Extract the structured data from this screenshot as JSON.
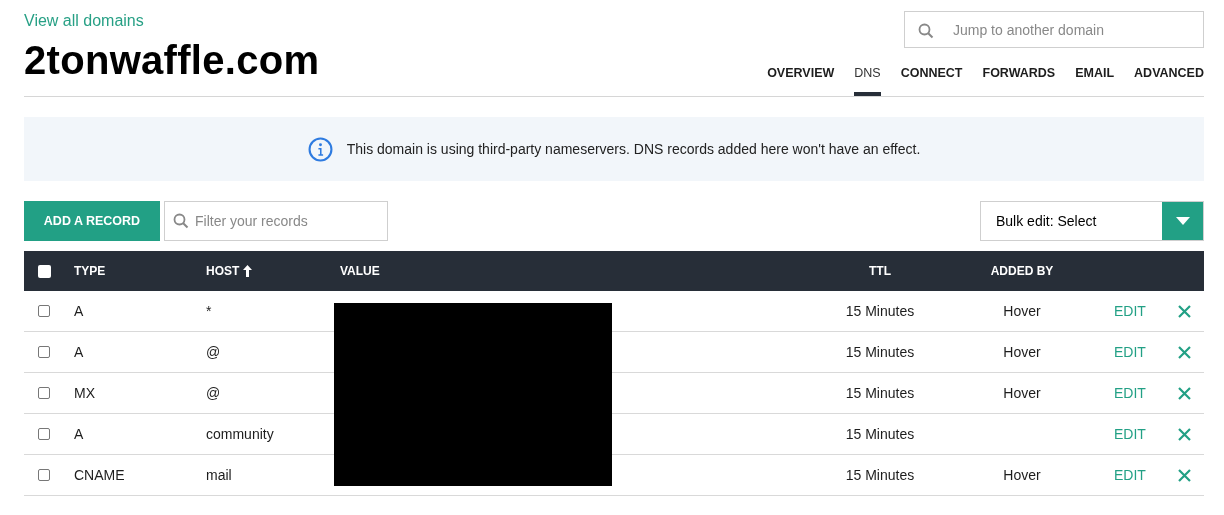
{
  "back_link": "View all domains",
  "domain_title": "2tonwaffle.com",
  "jump_search": {
    "placeholder": "Jump to another domain"
  },
  "tabs": [
    {
      "label": "OVERVIEW",
      "selected": false
    },
    {
      "label": "DNS",
      "selected": true
    },
    {
      "label": "CONNECT",
      "selected": false
    },
    {
      "label": "FORWARDS",
      "selected": false
    },
    {
      "label": "EMAIL",
      "selected": false
    },
    {
      "label": "ADVANCED",
      "selected": false
    }
  ],
  "notice": "This domain is using third-party nameservers. DNS records added here won't have an effect.",
  "add_button": "ADD A RECORD",
  "filter": {
    "placeholder": "Filter your records"
  },
  "bulk_edit": "Bulk edit: Select",
  "table": {
    "select_all_checked": false,
    "columns": [
      "TYPE",
      "HOST",
      "VALUE",
      "TTL",
      "ADDED BY"
    ],
    "rows": [
      {
        "checked": false,
        "type": "A",
        "host": "*",
        "ttl": "15 Minutes",
        "added_by": "Hover",
        "action": "EDIT"
      },
      {
        "checked": false,
        "type": "A",
        "host": "@",
        "ttl": "15 Minutes",
        "added_by": "Hover",
        "action": "EDIT"
      },
      {
        "checked": false,
        "type": "MX",
        "host": "@",
        "ttl": "15 Minutes",
        "added_by": "Hover",
        "action": "EDIT"
      },
      {
        "checked": false,
        "type": "A",
        "host": "community",
        "ttl": "15 Minutes",
        "action": "EDIT"
      },
      {
        "checked": false,
        "type": "CNAME",
        "host": "mail",
        "ttl": "15 Minutes",
        "added_by": "Hover",
        "action": "EDIT"
      }
    ]
  }
}
